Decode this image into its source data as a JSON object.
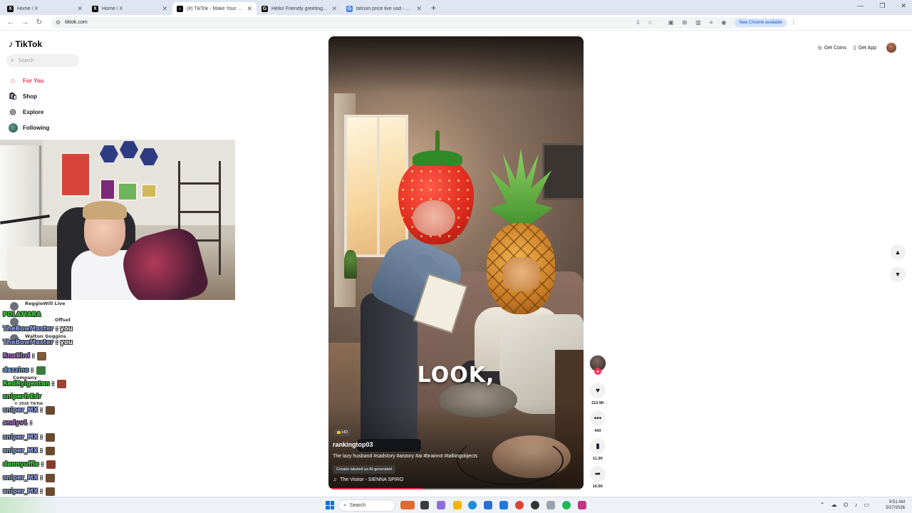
{
  "browser": {
    "tabs": [
      {
        "title": "Home / X",
        "favicon": "X",
        "color": "#000000"
      },
      {
        "title": "Home / X",
        "favicon": "X",
        "color": "#000000"
      },
      {
        "title": "(#) TikTok - Make Your Day",
        "favicon": "♪",
        "color": "#000000",
        "active": true
      },
      {
        "title": "Hello! Friendly greeting - Grok",
        "favicon": "G",
        "color": "#111111"
      },
      {
        "title": "bitcoin price live usd - Google",
        "favicon": "G",
        "color": "#4285f4"
      }
    ],
    "url": "tiktok.com",
    "chrome_badge": "New Chrome available"
  },
  "sidebar": {
    "logo_text": "TikTok",
    "search_placeholder": "Search",
    "nav": [
      {
        "label": "For You",
        "icon": "home-icon",
        "active": true
      },
      {
        "label": "Shop",
        "icon": "shopping-bag-icon"
      },
      {
        "label": "Explore",
        "icon": "compass-icon"
      },
      {
        "label": "Following",
        "icon": "following-avatar-icon"
      }
    ]
  },
  "chat": {
    "ghost_items": [
      "ReggieWill Live",
      "Offset",
      "Walton Goggins",
      "Company",
      "© 2026 TikTok"
    ],
    "lines": [
      {
        "user": "POLAMARA",
        "color": "#3fd13f",
        "msg": "",
        "emote": false
      },
      {
        "user": "TheBowMaster",
        "color": "#9aa0f0",
        "msg": ": you",
        "emote": false
      },
      {
        "user": "TheBowMaster",
        "color": "#9aa0f0",
        "msg": ": you",
        "emote": false
      },
      {
        "user": "RnaBird",
        "color": "#b36cd6",
        "msg": ":",
        "emote": true,
        "emote_color": "#7a5a3a"
      },
      {
        "user": "dazzino",
        "color": "#8aa8f5",
        "msg": ":",
        "emote": true,
        "emote_color": "#3d7a3d"
      },
      {
        "user": "RedRylgestan",
        "color": "#3fd13f",
        "msg": ":",
        "emote": true,
        "emote_color": "#a0402f"
      },
      {
        "user": "sniperfrEdr",
        "color": "#3fd13f",
        "msg": "",
        "emote": false
      },
      {
        "user": "sniper_MX",
        "color": "#9aa0f0",
        "msg": ":",
        "emote": true,
        "emote_color": "#6b4a2e"
      },
      {
        "user": "andyv1",
        "color": "#b36cd6",
        "msg": ":",
        "emote": false
      },
      {
        "user": "sniper_MX",
        "color": "#9aa0f0",
        "msg": ":",
        "emote": true,
        "emote_color": "#6b4a2e"
      },
      {
        "user": "sniper_MX",
        "color": "#9aa0f0",
        "msg": ":",
        "emote": true,
        "emote_color": "#6b4a2e"
      },
      {
        "user": "dannyuffle",
        "color": "#3fd13f",
        "msg": ":",
        "emote": true,
        "emote_color": "#8a3a2a"
      },
      {
        "user": "sniper_MX",
        "color": "#9aa0f0",
        "msg": ":",
        "emote": true,
        "emote_color": "#6b4a2e"
      },
      {
        "user": "sniper_MX",
        "color": "#9aa0f0",
        "msg": ":",
        "emote": true,
        "emote_color": "#6b4a2e"
      },
      {
        "user": "sniperfreat",
        "color": "#3fd13f",
        "msg": ":",
        "emote": true,
        "emote_color": "#444444"
      }
    ]
  },
  "video": {
    "caption_word": "LOOK,",
    "hd_label": "HD",
    "author": "rankingtop03",
    "description": "The lazy husband #sadstory #aistory #ai #brainrot #talkingobjects",
    "ai_label": "Creator labeled as AI-generated",
    "music": "The Visitor - SIENNA SPIRO",
    "progress": 0.37
  },
  "actions": {
    "likes": "212.9K",
    "comments": "443",
    "saves": "11.3K",
    "shares": "16.5K"
  },
  "header_right": {
    "coins_label": "Get Coins",
    "app_label": "Get App"
  },
  "taskbar": {
    "search_label": "Search",
    "time": "9:51 AM",
    "date": "5/27/2026"
  }
}
